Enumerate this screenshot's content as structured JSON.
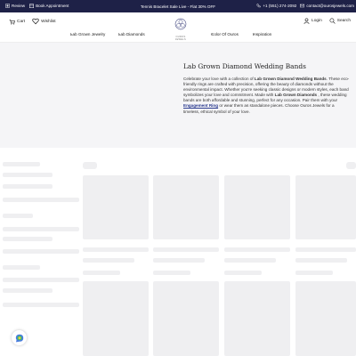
{
  "topbar": {
    "review": "Review",
    "book": "Book Appointment",
    "promo": "Tennis Bracelet Sale Live - Flat 30% OFF",
    "phone": "+1 (551) 274-2092",
    "email": "contact@ourosjewels.com"
  },
  "header": {
    "cart": "Cart",
    "wishlist": "Wishlist",
    "brand": "OUROS JEWELS",
    "login": "Login",
    "search": "Search"
  },
  "nav": {
    "items": [
      "Lab Grown Jewelry",
      "Lab Diamonds",
      "Color Of Ouros",
      "Inspiration"
    ]
  },
  "hero": {
    "title": "Lab Grown Diamond Wedding Bands",
    "p1": "Celebrate your love with a collection of ",
    "b1": "Lab Grown Diamond Wedding Bands",
    "p2": ". These eco-friendly rings are crafted with precision, offering the beauty of diamonds without the environmental impact. Whether you're seeking classic designs or modern styles, each band symbolizes your love and commitment. Made with ",
    "b2": "Lab Grown Diamonds",
    "p3": " , these wedding bands are both affordable and stunning, perfect for any occasion. Pair them with your ",
    "link": "Engagement Ring",
    "p4": " or wear them as standalone pieces. Choose Ouros Jewels for a timeless, ethical symbol of your love."
  },
  "colors": {
    "topbar": "#1e2147",
    "skeleton": "#efeff1",
    "hero_bg": "#f5f5f7",
    "link": "#2a3a8f"
  }
}
